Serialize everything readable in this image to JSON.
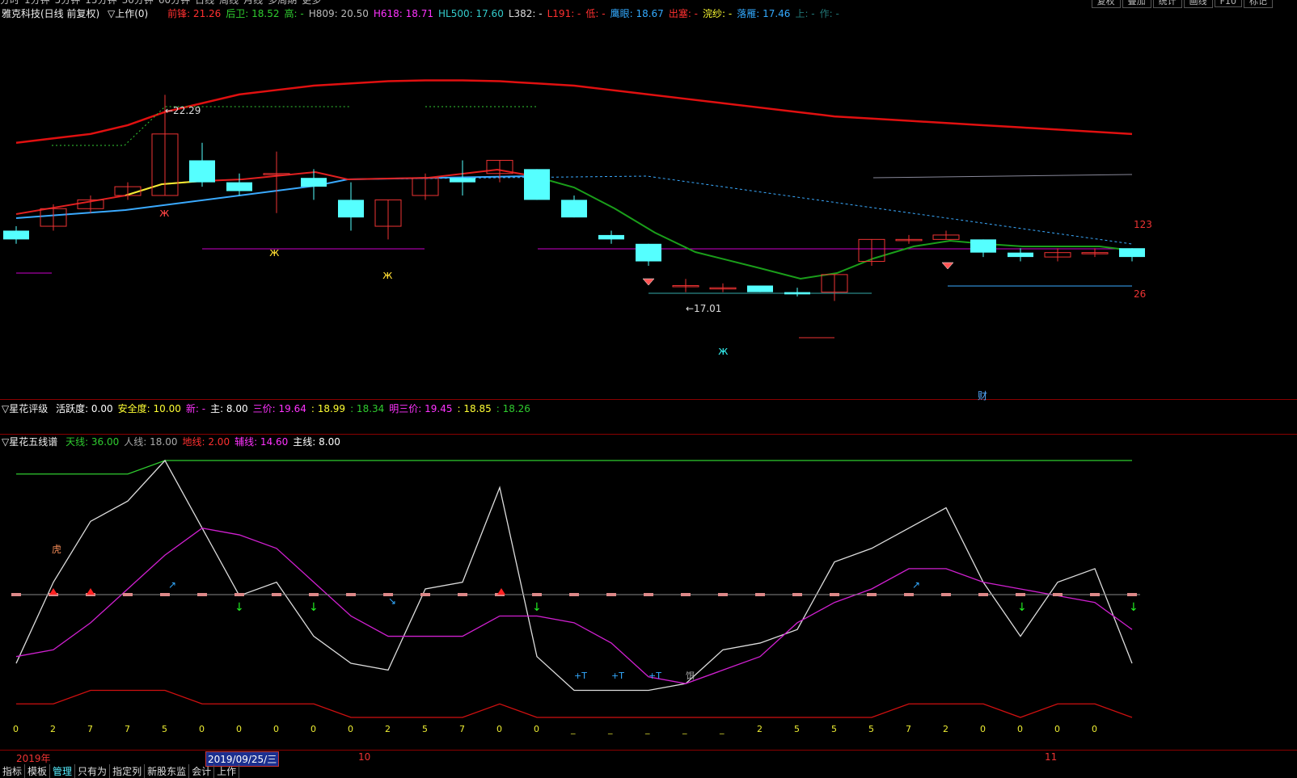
{
  "top_menu": [
    "分时",
    "1分钟",
    "5分钟",
    "15分钟",
    "30分钟",
    "60分钟",
    "日线",
    "周线",
    "月线",
    "多周期",
    "更多"
  ],
  "top_right_buttons": [
    "复权",
    "叠加",
    "统计",
    "画线",
    "F10",
    "标记"
  ],
  "header": {
    "stock": "雅克科技(日线 前复权)",
    "formula": "▽上作(0)",
    "items": [
      {
        "label": "前锋:",
        "value": "21.26",
        "color": "#ff3030"
      },
      {
        "label": "后卫:",
        "value": "18.52",
        "color": "#2fcc2f"
      },
      {
        "label": "高:",
        "value": "-",
        "color": "#2fcc2f"
      },
      {
        "label": "H809:",
        "value": "20.50",
        "color": "#bbbbbb"
      },
      {
        "label": "H618:",
        "value": "18.71",
        "color": "#ff33ff"
      },
      {
        "label": "HL500:",
        "value": "17.60",
        "color": "#33cccc"
      },
      {
        "label": "L382:",
        "value": "-",
        "color": "#dddddd"
      },
      {
        "label": "L191:",
        "value": "-",
        "color": "#ff3030"
      },
      {
        "label": "低:",
        "value": "-",
        "color": "#ff3030"
      },
      {
        "label": "鹰眼:",
        "value": "18.67",
        "color": "#33aaff"
      },
      {
        "label": "出塞:",
        "value": "-",
        "color": "#ff3030"
      },
      {
        "label": "浣纱:",
        "value": "-",
        "color": "#ffff33"
      },
      {
        "label": "落雁:",
        "value": "17.46",
        "color": "#33aaff"
      },
      {
        "label": "上:",
        "value": "-",
        "color": "#227777"
      },
      {
        "label": "作:",
        "value": "-",
        "color": "#227777"
      }
    ]
  },
  "panel2": {
    "title": "▽星花评级",
    "items": [
      {
        "label": "活跃度:",
        "value": "0.00",
        "color": "#ffffff"
      },
      {
        "label": "安全度:",
        "value": "10.00",
        "color": "#ffff33"
      },
      {
        "label": "新:",
        "value": "-",
        "color": "#ff33ff"
      },
      {
        "label": "主:",
        "value": "8.00",
        "color": "#ffffff"
      },
      {
        "label": "三价:",
        "value": "19.64",
        "color": "#ff33ff"
      },
      {
        "label": ":",
        "value": "18.99",
        "color": "#ffff33"
      },
      {
        "label": ":",
        "value": "18.34",
        "color": "#2fcc2f"
      },
      {
        "label": "明三价:",
        "value": "19.45",
        "color": "#ff33ff"
      },
      {
        "label": ":",
        "value": "18.85",
        "color": "#ffff33"
      },
      {
        "label": ":",
        "value": "18.26",
        "color": "#2fcc2f"
      }
    ]
  },
  "panel3": {
    "title": "▽星花五线谱",
    "items": [
      {
        "label": "天线:",
        "value": "36.00",
        "color": "#2fcc2f"
      },
      {
        "label": "人线:",
        "value": "18.00",
        "color": "#aaaaaa"
      },
      {
        "label": "地线:",
        "value": "2.00",
        "color": "#ff3030"
      },
      {
        "label": "辅线:",
        "value": "14.60",
        "color": "#ff33ff"
      },
      {
        "label": "主线:",
        "value": "8.00",
        "color": "#ffffff"
      }
    ]
  },
  "chart_annotations": {
    "high_label": "22.29",
    "low_label": "17.01",
    "right_top": "123",
    "right_bottom": "26",
    "cai_marker": "财",
    "hu_marker": "虎",
    "t_markers": [
      "+T",
      "+T",
      "+T"
    ],
    "ni_marker": "饵"
  },
  "bottom_numbers": [
    "0",
    "2",
    "7",
    "7",
    "5",
    "0",
    "0",
    "0",
    "0",
    "0",
    "2",
    "5",
    "7",
    "0",
    "0",
    "_",
    "_",
    "_",
    "_",
    "_",
    "2",
    "5",
    "5",
    "5",
    "7",
    "2",
    "0",
    "0",
    "0",
    "0"
  ],
  "date_labels": {
    "year": "2019年",
    "selected": "2019/09/25/三",
    "oct": "10",
    "nov": "11"
  },
  "bottom_tabs": [
    "指标",
    "模板",
    "管理",
    "只有为",
    "指定列",
    "新股东监",
    "会计",
    "上作"
  ],
  "chart_data": [
    {
      "type": "candlestick",
      "title": "雅克科技(日线 前复权)",
      "annotations": [
        "22.29",
        "17.01"
      ],
      "candles": [
        {
          "o": 19.2,
          "c": 19.0,
          "h": 19.3,
          "l": 18.9
        },
        {
          "o": 19.3,
          "c": 19.7,
          "h": 19.8,
          "l": 19.2
        },
        {
          "o": 19.7,
          "c": 19.9,
          "h": 20.0,
          "l": 19.6
        },
        {
          "o": 20.0,
          "c": 20.2,
          "h": 20.3,
          "l": 19.9
        },
        {
          "o": 20.0,
          "c": 21.4,
          "h": 22.29,
          "l": 20.0
        },
        {
          "o": 20.8,
          "c": 20.3,
          "h": 21.2,
          "l": 20.2
        },
        {
          "o": 20.3,
          "c": 20.1,
          "h": 20.5,
          "l": 20.0
        },
        {
          "o": 20.5,
          "c": 20.5,
          "h": 21.0,
          "l": 19.6
        },
        {
          "o": 20.4,
          "c": 20.2,
          "h": 20.6,
          "l": 19.9
        },
        {
          "o": 19.9,
          "c": 19.5,
          "h": 20.3,
          "l": 19.2
        },
        {
          "o": 19.3,
          "c": 19.9,
          "h": 19.9,
          "l": 19.0
        },
        {
          "o": 20.0,
          "c": 20.4,
          "h": 20.5,
          "l": 19.9
        },
        {
          "o": 20.4,
          "c": 20.3,
          "h": 20.8,
          "l": 20.0
        },
        {
          "o": 20.5,
          "c": 20.8,
          "h": 20.8,
          "l": 20.3
        },
        {
          "o": 20.6,
          "c": 19.9,
          "h": 20.6,
          "l": 19.9
        },
        {
          "o": 19.9,
          "c": 19.5,
          "h": 20.0,
          "l": 19.5
        },
        {
          "o": 19.1,
          "c": 19.0,
          "h": 19.2,
          "l": 18.9
        },
        {
          "o": 18.9,
          "c": 18.5,
          "h": 18.9,
          "l": 18.4
        },
        {
          "o": 17.95,
          "c": 17.95,
          "h": 18.1,
          "l": 17.8
        },
        {
          "o": 17.9,
          "c": 17.9,
          "h": 18.0,
          "l": 17.8
        },
        {
          "o": 17.95,
          "c": 17.8,
          "h": 17.95,
          "l": 17.8
        },
        {
          "o": 17.8,
          "c": 17.75,
          "h": 17.9,
          "l": 17.7
        },
        {
          "o": 17.8,
          "c": 18.2,
          "h": 18.2,
          "l": 17.6
        },
        {
          "o": 18.5,
          "c": 19.0,
          "h": 19.0,
          "l": 18.4
        },
        {
          "o": 19.0,
          "c": 19.0,
          "h": 19.1,
          "l": 18.9
        },
        {
          "o": 19.0,
          "c": 19.1,
          "h": 19.2,
          "l": 19.0
        },
        {
          "o": 19.0,
          "c": 18.7,
          "h": 19.0,
          "l": 18.6
        },
        {
          "o": 18.7,
          "c": 18.6,
          "h": 18.8,
          "l": 18.5
        },
        {
          "o": 18.6,
          "c": 18.7,
          "h": 18.8,
          "l": 18.5
        },
        {
          "o": 18.7,
          "c": 18.7,
          "h": 18.8,
          "l": 18.6
        },
        {
          "o": 18.8,
          "c": 18.6,
          "h": 18.8,
          "l": 18.5
        }
      ]
    },
    {
      "type": "line",
      "title": "星花五线谱",
      "ylim": [
        0,
        40
      ],
      "series": [
        {
          "name": "天线",
          "values": [
            36,
            36,
            36,
            36,
            38,
            38,
            38,
            38,
            38,
            38,
            38,
            38,
            38,
            38,
            38,
            38,
            38,
            38,
            38,
            38,
            38,
            38,
            38,
            38,
            38,
            38,
            38,
            38,
            38,
            38,
            38
          ]
        },
        {
          "name": "主线",
          "values": [
            8,
            20,
            29,
            32,
            38,
            28,
            18,
            20,
            12,
            8,
            7,
            19,
            20,
            34,
            9,
            4,
            4,
            4,
            5,
            10,
            11,
            13,
            23,
            25,
            28,
            31,
            20,
            12,
            20,
            22,
            8
          ]
        },
        {
          "name": "辅线",
          "values": [
            9,
            10,
            14,
            19,
            24,
            28,
            27,
            25,
            20,
            15,
            12,
            12,
            12,
            15,
            15,
            14,
            11,
            6,
            5,
            7,
            9,
            14,
            17,
            19,
            22,
            22,
            20,
            19,
            18,
            17,
            13
          ]
        },
        {
          "name": "地线",
          "values": [
            2,
            2,
            4,
            4,
            4,
            2,
            2,
            2,
            2,
            0,
            0,
            0,
            0,
            2,
            0,
            0,
            0,
            0,
            0,
            0,
            0,
            0,
            0,
            0,
            2,
            2,
            2,
            0,
            2,
            2,
            0
          ]
        }
      ]
    }
  ]
}
